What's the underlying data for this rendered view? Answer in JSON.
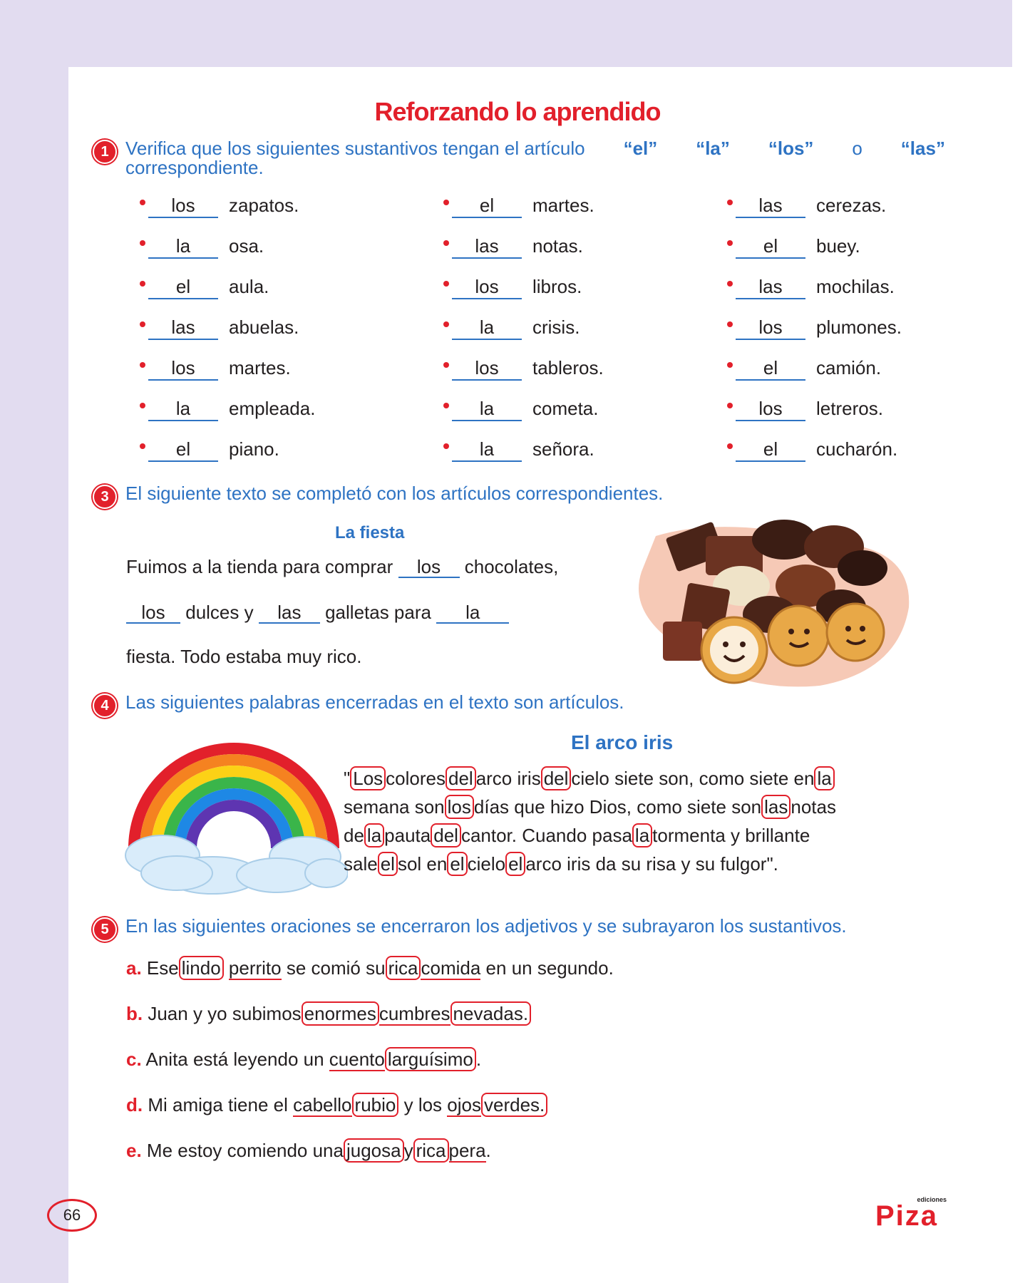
{
  "title": "Reforzando lo aprendido",
  "ex1": {
    "number": "1",
    "instruction_a": "Verifica que los siguientes sustantivos tengan el artículo ",
    "art_el": "“el”",
    "art_la": "“la”",
    "art_los": "“los”",
    "conj": "o",
    "art_las": "“las”",
    "instruction_b": "correspondiente.",
    "columns": [
      [
        {
          "answer": "los",
          "noun": "zapatos."
        },
        {
          "answer": "la",
          "noun": "osa."
        },
        {
          "answer": "el",
          "noun": "aula."
        },
        {
          "answer": "las",
          "noun": "abuelas."
        },
        {
          "answer": "los",
          "noun": "martes."
        },
        {
          "answer": "la",
          "noun": "empleada."
        },
        {
          "answer": "el",
          "noun": "piano."
        }
      ],
      [
        {
          "answer": "el",
          "noun": "martes."
        },
        {
          "answer": "las",
          "noun": "notas."
        },
        {
          "answer": "los",
          "noun": "libros."
        },
        {
          "answer": "la",
          "noun": "crisis."
        },
        {
          "answer": "los",
          "noun": "tableros."
        },
        {
          "answer": "la",
          "noun": "cometa."
        },
        {
          "answer": "la",
          "noun": "señora."
        }
      ],
      [
        {
          "answer": "las",
          "noun": "cerezas."
        },
        {
          "answer": "el",
          "noun": "buey."
        },
        {
          "answer": "las",
          "noun": "mochilas."
        },
        {
          "answer": "los",
          "noun": "plumones."
        },
        {
          "answer": "el",
          "noun": "camión."
        },
        {
          "answer": "los",
          "noun": "letreros."
        },
        {
          "answer": "el",
          "noun": "cucharón."
        }
      ]
    ]
  },
  "ex3": {
    "number": "3",
    "instruction": "El siguiente texto se completó con los artículos correspondientes.",
    "subtitle": "La fiesta",
    "l1_a": "Fuimos a la tienda para comprar",
    "b1": "los",
    "l1_b": "chocolates,",
    "b2": "los",
    "l2_a": "dulces y",
    "b3": "las",
    "l2_b": "galletas para",
    "b4": "la",
    "l3": "fiesta. Todo estaba muy rico."
  },
  "ex4": {
    "number": "4",
    "instruction": "Las siguientes palabras encerradas en el texto son artículos.",
    "subtitle": "El arco iris",
    "p1a": "\"",
    "c1": "Los",
    "p1b": "colores",
    "c2": "del",
    "p1c": "arco iris",
    "c3": "del",
    "p1d": "cielo siete son, como siete en",
    "c4": "la",
    "p2a": "semana son",
    "c5": "los",
    "p2b": "días que hizo Dios, como siete son",
    "c6": "las",
    "p2c": "notas",
    "p3a": "de",
    "c7": "la",
    "p3b": "pauta",
    "c8": "del",
    "p3c": "cantor. Cuando pasa",
    "c9": "la",
    "p3d": "tormenta y brillante",
    "p4a": "sale",
    "c10": "el",
    "p4b": "sol en",
    "c11": "el",
    "p4c": "cielo",
    "c12": "el",
    "p4d": "arco iris da su risa y su fulgor\"."
  },
  "ex5": {
    "number": "5",
    "instruction": "En las siguientes oraciones se encerraron los adjetivos y se subrayaron los sustantivos.",
    "a": {
      "l": "a.",
      "t1": "Ese",
      "adj1": "lindo",
      "n1": "perrito",
      "t2": "se comió su",
      "adj2": "rica",
      "n2": "comida",
      "t3": "en un segundo."
    },
    "b": {
      "l": "b.",
      "t1": "Juan y yo subimos",
      "adj1": "enormes",
      "n1": "cumbres",
      "adj2": "nevadas."
    },
    "c": {
      "l": "c.",
      "t1": "Anita está leyendo un",
      "n1": "cuento",
      "adj1": "larguísimo",
      "t2": "."
    },
    "d": {
      "l": "d.",
      "t1": "Mi amiga tiene el",
      "n1": "cabello",
      "adj1": "rubio",
      "t2": "y los",
      "n2": "ojos",
      "adj2": "verdes."
    },
    "e": {
      "l": "e.",
      "t1": "Me estoy comiendo una",
      "adj1": "jugosa",
      "t2": "y",
      "adj2": "rica",
      "n1": "pera",
      "t3": "."
    }
  },
  "footer": {
    "page": "66",
    "logo_small": "ediciones",
    "logo": "Piza"
  },
  "colors": {
    "accent_red": "#e2202b",
    "accent_blue": "#2e73c3",
    "band": "#e2dcf0"
  }
}
